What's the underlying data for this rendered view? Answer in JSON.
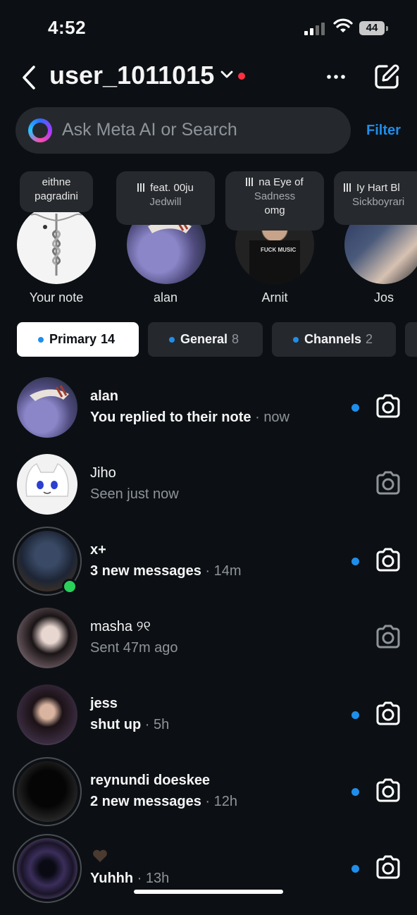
{
  "status_bar": {
    "time": "4:52",
    "battery": "44"
  },
  "header": {
    "username": "user_1011015"
  },
  "search": {
    "placeholder": "Ask Meta AI or Search",
    "filter_label": "Filter"
  },
  "notes": [
    {
      "name": "Your note",
      "line1": "eithne",
      "line2": "pagradini",
      "music": false
    },
    {
      "name": "alan",
      "line1": "feat. 00ju",
      "line2": "Jedwill",
      "music": true
    },
    {
      "name": "Arnit",
      "line1": "na   Eye of",
      "line2": "Sadness",
      "line3": "omg",
      "music": true
    },
    {
      "name": "Jos",
      "line1": "Iy Hart Bl",
      "line2": "Sickboyrari",
      "music": true
    }
  ],
  "tabs": [
    {
      "label": "Primary",
      "count": "14"
    },
    {
      "label": "General",
      "count": "8"
    },
    {
      "label": "Channels",
      "count": "2"
    }
  ],
  "conversations": [
    {
      "name": "alan",
      "message": "You replied to their note",
      "time": "now",
      "unread": true
    },
    {
      "name": "Jiho",
      "message": "Seen just now",
      "time": "",
      "unread": false
    },
    {
      "name": "x+",
      "message": "3 new messages",
      "time": "14m",
      "unread": true,
      "online": true
    },
    {
      "name": "masha ୨୧",
      "message": "Sent 47m ago",
      "time": "",
      "unread": false
    },
    {
      "name": "jess",
      "message": "shut up",
      "time": "5h",
      "unread": true
    },
    {
      "name": "reynundi doeskee",
      "message": "2 new messages",
      "time": "12h",
      "unread": true
    },
    {
      "name": "",
      "message": "Yuhhh",
      "time": "13h",
      "unread": true
    }
  ],
  "colors": {
    "accent": "#1f8eeb",
    "background": "#0c1014",
    "online": "#29d15a",
    "notification": "#ff3040"
  }
}
